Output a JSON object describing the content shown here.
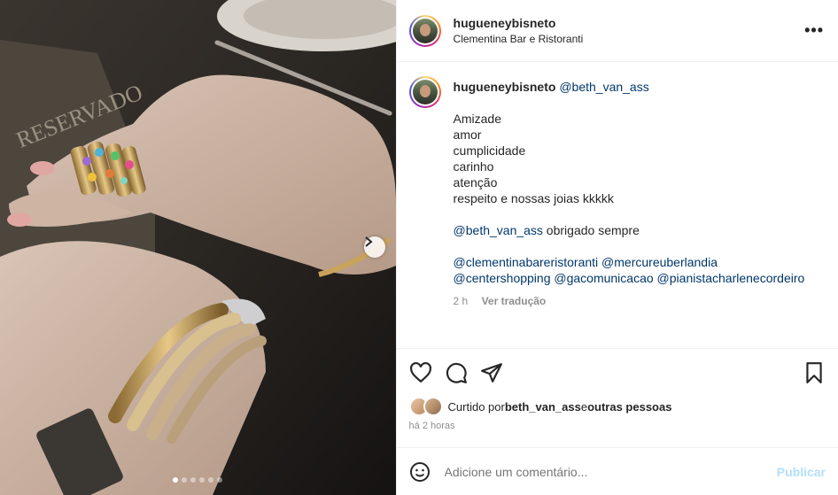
{
  "header": {
    "username": "hugueneybisneto",
    "location": "Clementina Bar e Ristoranti"
  },
  "caption": {
    "username": "hugueneybisneto",
    "mention": "@beth_van_ass",
    "lines": [
      "Amizade",
      "amor",
      "cumplicidade",
      "carinho",
      "atenção",
      "respeito e nossas joias kkkkk"
    ],
    "thanks_mention": "@beth_van_ass",
    "thanks_text": " obrigado sempre",
    "tags_line1": [
      "@clementinabareristoranti",
      "@mercureuberlandia"
    ],
    "tags_line2": [
      "@centershopping",
      "@gacomunicacao",
      "@pianistacharlenecordeiro"
    ],
    "time": "2 h",
    "translate": "Ver tradução"
  },
  "likes": {
    "prefix": "Curtido por ",
    "user": "beth_van_ass",
    "middle": " e ",
    "others": "outras pessoas"
  },
  "posted_ago": "há 2 horas",
  "comment_box": {
    "placeholder": "Adicione um comentário...",
    "publish": "Publicar"
  },
  "media": {
    "card_text": "RESERVADO",
    "slides": 6,
    "active_slide": 1
  },
  "icons": {
    "more": "more-options-icon",
    "like": "heart-icon",
    "comment": "comment-icon",
    "share": "share-icon",
    "save": "bookmark-icon",
    "emoji": "emoji-icon",
    "next": "chevron-right-icon"
  }
}
